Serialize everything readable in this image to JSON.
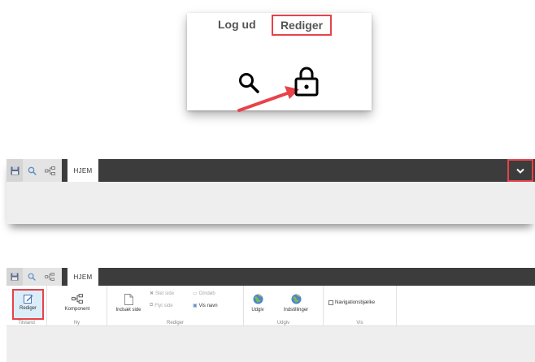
{
  "popup": {
    "logout_label": "Log ud",
    "edit_label": "Rediger",
    "icons": [
      "search-icon",
      "lock-icon"
    ],
    "highlight_color": "#e8424a",
    "arrow_color": "#e8424a"
  },
  "toolbar": {
    "home_tab": "HJEM",
    "quick_icons": [
      "save-icon",
      "search-icon",
      "sitemap-icon"
    ],
    "bar_color": "#3c3c3c",
    "collapse_icon": "chevron-down-icon"
  },
  "ribbon": {
    "edit_button": "Rediger",
    "component_button": "Komponent",
    "insert_page_button": "Indsæt side",
    "delete_page": "Slet side",
    "rename": "Omdøb",
    "move_page": "Flyt side",
    "show_name": "Vis navn",
    "publish_button": "Udgiv",
    "settings_button": "Indstillinger",
    "navigation_bar": "Navigationsbjælke",
    "groups": {
      "state": "Tilstand",
      "new": "Ny",
      "edit": "Rediger",
      "publish": "Udgiv",
      "show": "Vis"
    }
  }
}
